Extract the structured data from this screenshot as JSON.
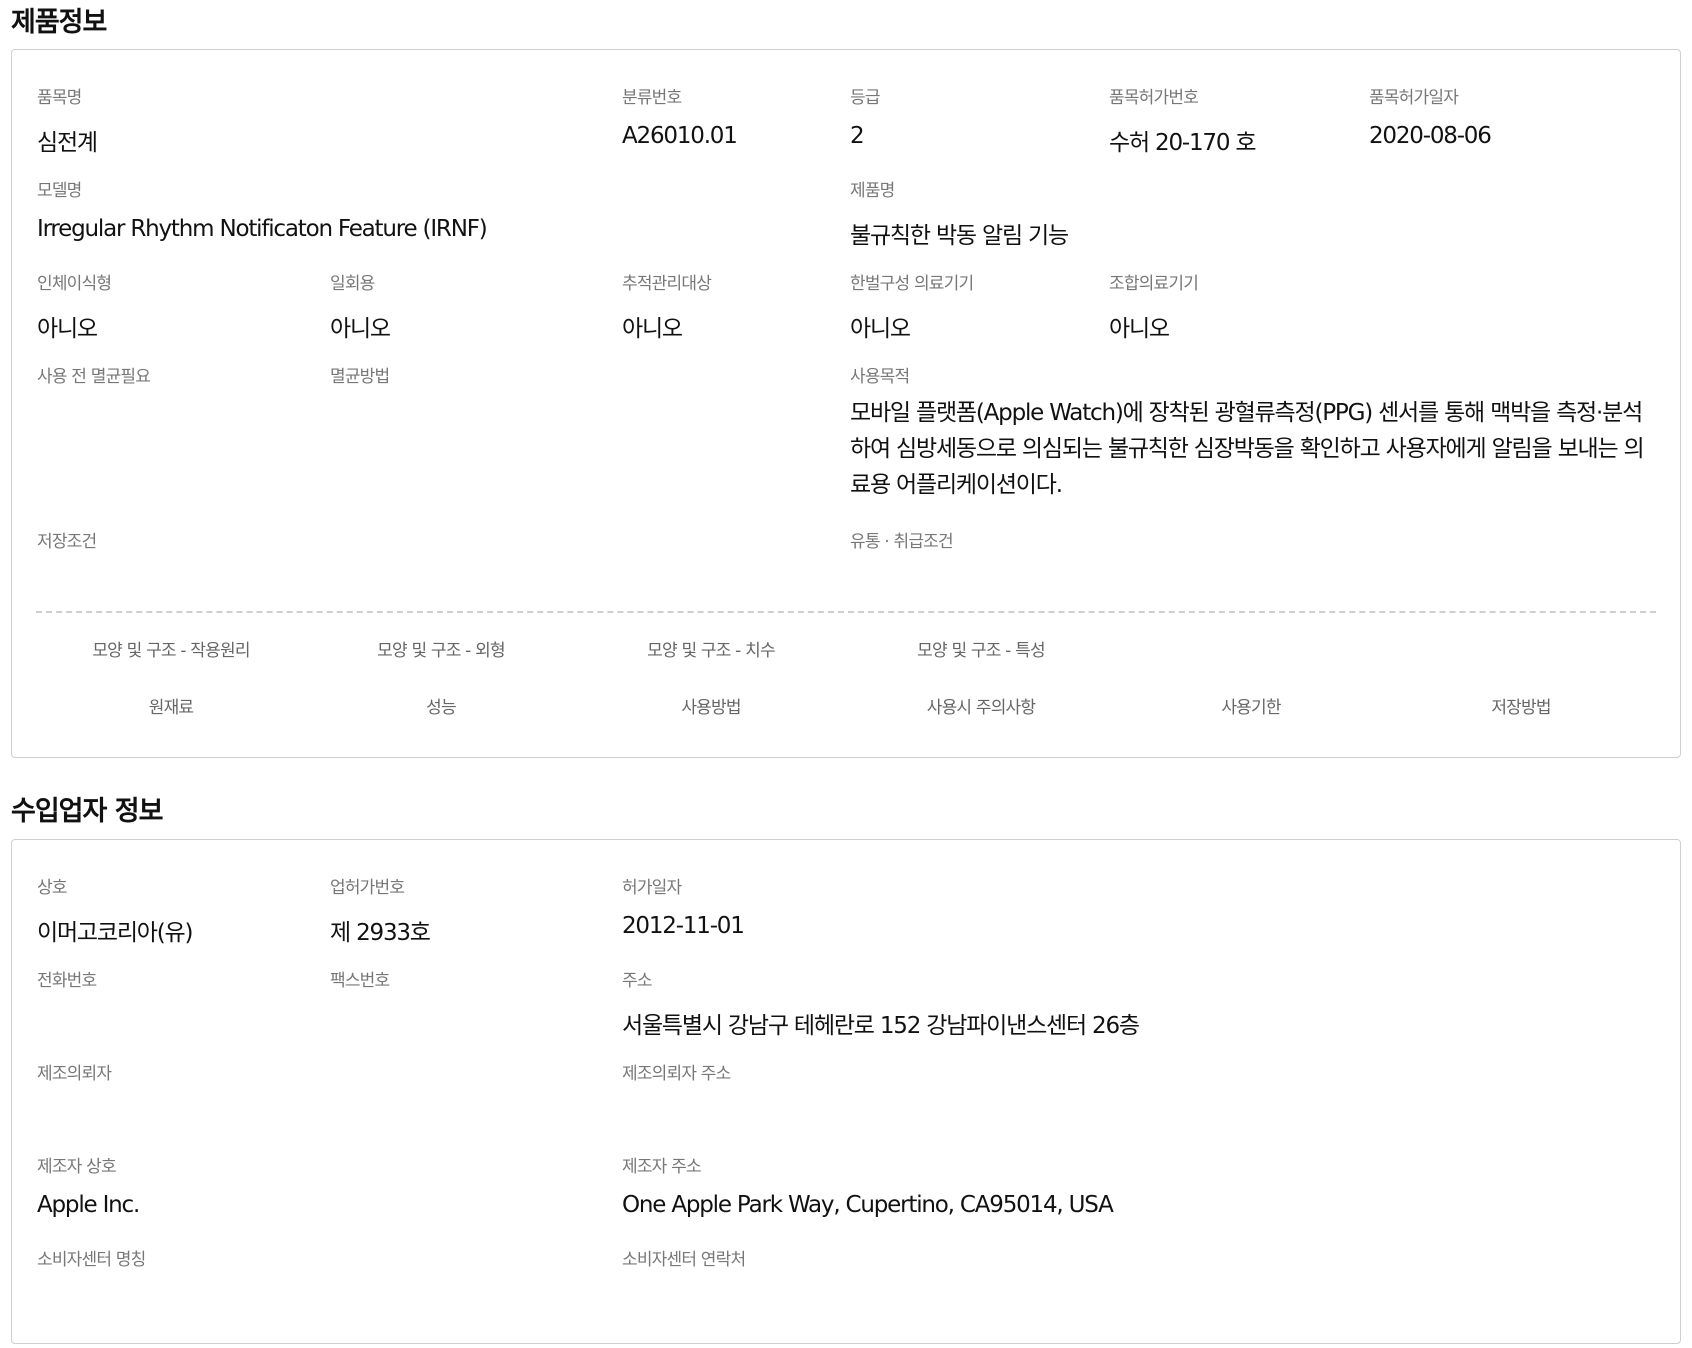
{
  "product": {
    "title": "제품정보",
    "item_name": {
      "label": "품목명",
      "value": "심전계"
    },
    "class_no": {
      "label": "분류번호",
      "value": "A26010.01"
    },
    "grade": {
      "label": "등급",
      "value": "2"
    },
    "permit_no": {
      "label": "품목허가번호",
      "value": "수허 20-170 호"
    },
    "permit_date": {
      "label": "품목허가일자",
      "value": "2020-08-06"
    },
    "model": {
      "label": "모델명",
      "value": "Irregular Rhythm Notificaton Feature (IRNF)"
    },
    "product_name": {
      "label": "제품명",
      "value": "불규칙한 박동 알림 기능"
    },
    "implant": {
      "label": "인체이식형",
      "value": "아니오"
    },
    "single_use": {
      "label": "일회용",
      "value": "아니오"
    },
    "tracking": {
      "label": "추적관리대상",
      "value": "아니오"
    },
    "korean_device": {
      "label": "한벌구성 의료기기",
      "value": "아니오"
    },
    "combination": {
      "label": "조합의료기기",
      "value": "아니오"
    },
    "sterilize_needed": {
      "label": "사용 전 멸균필요",
      "value": ""
    },
    "sterilize_method": {
      "label": "멸균방법",
      "value": ""
    },
    "purpose": {
      "label": "사용목적",
      "value": "모바일 플랫폼(Apple Watch)에 장착된 광혈류측정(PPG) 센서를 통해 맥박을 측정·분석하여 심방세동으로 의심되는 불규칙한 심장박동을 확인하고 사용자에게 알림을 보내는 의료용 어플리케이션이다."
    },
    "storage": {
      "label": "저장조건",
      "value": ""
    },
    "distribution": {
      "label": "유통 · 취급조건",
      "value": ""
    },
    "links_row1": [
      "모양 및 구조 - 작용원리",
      "모양 및 구조 - 외형",
      "모양 및 구조 - 치수",
      "모양 및 구조 - 특성"
    ],
    "links_row2": [
      "원재료",
      "성능",
      "사용방법",
      "사용시 주의사항",
      "사용기한",
      "저장방법"
    ]
  },
  "importer": {
    "title": "수입업자 정보",
    "company": {
      "label": "상호",
      "value": "이머고코리아(유)"
    },
    "license_no": {
      "label": "업허가번호",
      "value": "제 2933호"
    },
    "license_date": {
      "label": "허가일자",
      "value": "2012-11-01"
    },
    "phone": {
      "label": "전화번호",
      "value": ""
    },
    "fax": {
      "label": "팩스번호",
      "value": ""
    },
    "address": {
      "label": "주소",
      "value": "서울특별시 강남구 테헤란로 152 강남파이낸스센터 26층"
    },
    "client": {
      "label": "제조의뢰자",
      "value": ""
    },
    "client_address": {
      "label": "제조의뢰자 주소",
      "value": ""
    },
    "maker": {
      "label": "제조자 상호",
      "value": "Apple Inc."
    },
    "maker_address": {
      "label": "제조자 주소",
      "value": "One Apple Park Way, Cupertino, CA95014, USA"
    },
    "cs_name": {
      "label": "소비자센터 명칭",
      "value": ""
    },
    "cs_contact": {
      "label": "소비자센터 연락처",
      "value": ""
    }
  }
}
